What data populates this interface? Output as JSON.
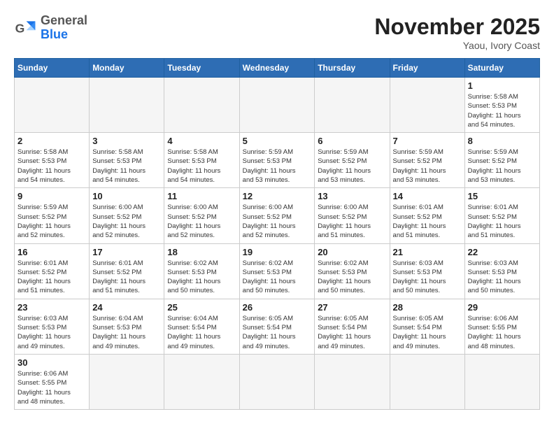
{
  "header": {
    "logo_general": "General",
    "logo_blue": "Blue",
    "month_title": "November 2025",
    "location": "Yaou, Ivory Coast"
  },
  "days_of_week": [
    "Sunday",
    "Monday",
    "Tuesday",
    "Wednesday",
    "Thursday",
    "Friday",
    "Saturday"
  ],
  "weeks": [
    [
      {
        "day": "",
        "info": ""
      },
      {
        "day": "",
        "info": ""
      },
      {
        "day": "",
        "info": ""
      },
      {
        "day": "",
        "info": ""
      },
      {
        "day": "",
        "info": ""
      },
      {
        "day": "",
        "info": ""
      },
      {
        "day": "1",
        "info": "Sunrise: 5:58 AM\nSunset: 5:53 PM\nDaylight: 11 hours\nand 54 minutes."
      }
    ],
    [
      {
        "day": "2",
        "info": "Sunrise: 5:58 AM\nSunset: 5:53 PM\nDaylight: 11 hours\nand 54 minutes."
      },
      {
        "day": "3",
        "info": "Sunrise: 5:58 AM\nSunset: 5:53 PM\nDaylight: 11 hours\nand 54 minutes."
      },
      {
        "day": "4",
        "info": "Sunrise: 5:58 AM\nSunset: 5:53 PM\nDaylight: 11 hours\nand 54 minutes."
      },
      {
        "day": "5",
        "info": "Sunrise: 5:59 AM\nSunset: 5:53 PM\nDaylight: 11 hours\nand 53 minutes."
      },
      {
        "day": "6",
        "info": "Sunrise: 5:59 AM\nSunset: 5:52 PM\nDaylight: 11 hours\nand 53 minutes."
      },
      {
        "day": "7",
        "info": "Sunrise: 5:59 AM\nSunset: 5:52 PM\nDaylight: 11 hours\nand 53 minutes."
      },
      {
        "day": "8",
        "info": "Sunrise: 5:59 AM\nSunset: 5:52 PM\nDaylight: 11 hours\nand 53 minutes."
      }
    ],
    [
      {
        "day": "9",
        "info": "Sunrise: 5:59 AM\nSunset: 5:52 PM\nDaylight: 11 hours\nand 52 minutes."
      },
      {
        "day": "10",
        "info": "Sunrise: 6:00 AM\nSunset: 5:52 PM\nDaylight: 11 hours\nand 52 minutes."
      },
      {
        "day": "11",
        "info": "Sunrise: 6:00 AM\nSunset: 5:52 PM\nDaylight: 11 hours\nand 52 minutes."
      },
      {
        "day": "12",
        "info": "Sunrise: 6:00 AM\nSunset: 5:52 PM\nDaylight: 11 hours\nand 52 minutes."
      },
      {
        "day": "13",
        "info": "Sunrise: 6:00 AM\nSunset: 5:52 PM\nDaylight: 11 hours\nand 51 minutes."
      },
      {
        "day": "14",
        "info": "Sunrise: 6:01 AM\nSunset: 5:52 PM\nDaylight: 11 hours\nand 51 minutes."
      },
      {
        "day": "15",
        "info": "Sunrise: 6:01 AM\nSunset: 5:52 PM\nDaylight: 11 hours\nand 51 minutes."
      }
    ],
    [
      {
        "day": "16",
        "info": "Sunrise: 6:01 AM\nSunset: 5:52 PM\nDaylight: 11 hours\nand 51 minutes."
      },
      {
        "day": "17",
        "info": "Sunrise: 6:01 AM\nSunset: 5:52 PM\nDaylight: 11 hours\nand 51 minutes."
      },
      {
        "day": "18",
        "info": "Sunrise: 6:02 AM\nSunset: 5:53 PM\nDaylight: 11 hours\nand 50 minutes."
      },
      {
        "day": "19",
        "info": "Sunrise: 6:02 AM\nSunset: 5:53 PM\nDaylight: 11 hours\nand 50 minutes."
      },
      {
        "day": "20",
        "info": "Sunrise: 6:02 AM\nSunset: 5:53 PM\nDaylight: 11 hours\nand 50 minutes."
      },
      {
        "day": "21",
        "info": "Sunrise: 6:03 AM\nSunset: 5:53 PM\nDaylight: 11 hours\nand 50 minutes."
      },
      {
        "day": "22",
        "info": "Sunrise: 6:03 AM\nSunset: 5:53 PM\nDaylight: 11 hours\nand 50 minutes."
      }
    ],
    [
      {
        "day": "23",
        "info": "Sunrise: 6:03 AM\nSunset: 5:53 PM\nDaylight: 11 hours\nand 49 minutes."
      },
      {
        "day": "24",
        "info": "Sunrise: 6:04 AM\nSunset: 5:53 PM\nDaylight: 11 hours\nand 49 minutes."
      },
      {
        "day": "25",
        "info": "Sunrise: 6:04 AM\nSunset: 5:54 PM\nDaylight: 11 hours\nand 49 minutes."
      },
      {
        "day": "26",
        "info": "Sunrise: 6:05 AM\nSunset: 5:54 PM\nDaylight: 11 hours\nand 49 minutes."
      },
      {
        "day": "27",
        "info": "Sunrise: 6:05 AM\nSunset: 5:54 PM\nDaylight: 11 hours\nand 49 minutes."
      },
      {
        "day": "28",
        "info": "Sunrise: 6:05 AM\nSunset: 5:54 PM\nDaylight: 11 hours\nand 49 minutes."
      },
      {
        "day": "29",
        "info": "Sunrise: 6:06 AM\nSunset: 5:55 PM\nDaylight: 11 hours\nand 48 minutes."
      }
    ],
    [
      {
        "day": "30",
        "info": "Sunrise: 6:06 AM\nSunset: 5:55 PM\nDaylight: 11 hours\nand 48 minutes."
      },
      {
        "day": "",
        "info": ""
      },
      {
        "day": "",
        "info": ""
      },
      {
        "day": "",
        "info": ""
      },
      {
        "day": "",
        "info": ""
      },
      {
        "day": "",
        "info": ""
      },
      {
        "day": "",
        "info": ""
      }
    ]
  ]
}
